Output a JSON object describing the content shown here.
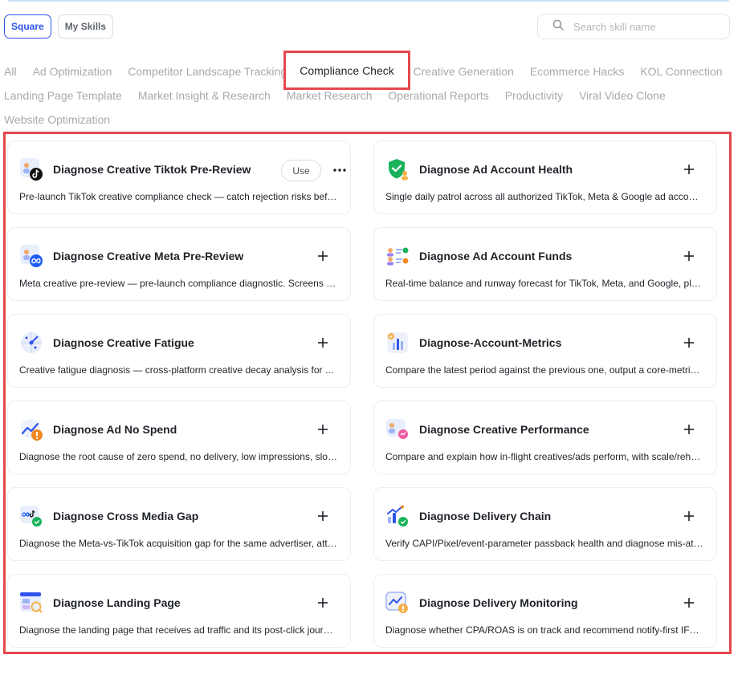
{
  "header": {
    "tabs": [
      {
        "label": "Square",
        "active": true
      },
      {
        "label": "My Skills",
        "active": false
      }
    ],
    "search": {
      "placeholder": "Search skill name",
      "value": ""
    }
  },
  "categories": {
    "row1": [
      "All",
      "Ad Optimization",
      "Competitor Landscape Tracking"
    ],
    "active": "Compliance Check",
    "row1_after": [
      "Creative Generation",
      "Ecommerce Hacks",
      "KOL Connection"
    ],
    "row2": [
      "Landing Page Template",
      "Market Insight & Research",
      "Market Research",
      "Operational Reports",
      "Productivity",
      "Viral Video Clone"
    ],
    "row3": [
      "Website Optimization"
    ]
  },
  "skills": [
    {
      "title": "Diagnose Creative Tiktok Pre-Review",
      "desc": "Pre-launch TikTok creative compliance check — catch rejection risks before ...",
      "icon": "tiktok-creative-icon",
      "action": "use"
    },
    {
      "title": "Diagnose Ad Account Health",
      "desc": "Single daily patrol across all authorized TikTok, Meta & Google ad accounts ...",
      "icon": "shield-check-icon",
      "action": "add"
    },
    {
      "title": "Diagnose Creative Meta Pre-Review",
      "desc": "Meta creative pre-review — pre-launch compliance diagnostic. Screens Met...",
      "icon": "meta-creative-icon",
      "action": "add"
    },
    {
      "title": "Diagnose Ad Account Funds",
      "desc": "Real-time balance and runway forecast for TikTok, Meta, and Google, plus s...",
      "icon": "account-funds-icon",
      "action": "add"
    },
    {
      "title": "Diagnose Creative Fatigue",
      "desc": "Creative fatigue diagnosis — cross-platform creative decay analysis for TikT...",
      "icon": "radar-icon",
      "action": "add"
    },
    {
      "title": "Diagnose-Account-Metrics",
      "desc": "Compare the latest period against the previous one, output a core-metric o...",
      "icon": "bar-chart-icon",
      "action": "add"
    },
    {
      "title": "Diagnose Ad No Spend",
      "desc": "Diagnose the root cause of zero spend, no delivery, low impressions, slow s...",
      "icon": "trend-warning-icon",
      "action": "add"
    },
    {
      "title": "Diagnose Creative Performance",
      "desc": "Compare and explain how in-flight creatives/ads perform, with scale/reheat...",
      "icon": "creative-performance-icon",
      "action": "add"
    },
    {
      "title": "Diagnose Cross Media Gap",
      "desc": "Diagnose the Meta-vs-TikTok acquisition gap for the same advertiser, attrib...",
      "icon": "cross-media-icon",
      "action": "add"
    },
    {
      "title": "Diagnose Delivery Chain",
      "desc": "Verify CAPI/Pixel/event-parameter passback health and diagnose mis-attrib...",
      "icon": "delivery-chain-icon",
      "action": "add"
    },
    {
      "title": "Diagnose Landing Page",
      "desc": "Diagnose the landing page that receives ad traffic and its post-click journey...",
      "icon": "landing-page-icon",
      "action": "add"
    },
    {
      "title": "Diagnose Delivery Monitoring",
      "desc": "Diagnose whether CPA/ROAS is on track and recommend notify-first IF→TH...",
      "icon": "delivery-monitoring-icon",
      "action": "add"
    }
  ],
  "labels": {
    "use": "Use"
  },
  "colors": {
    "accent": "#2f54eb",
    "highlight": "#e5484d"
  }
}
